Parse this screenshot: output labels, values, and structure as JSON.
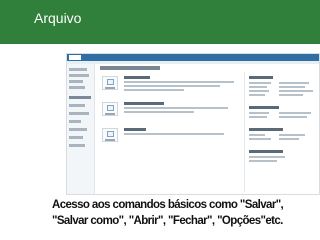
{
  "header": {
    "title": "Arquivo"
  },
  "caption": {
    "text": "Acesso aos comandos básicos como \"Salvar\", \"Salvar como\", \"Abrir\", \"Fechar\", \"Opções\"etc."
  },
  "colors": {
    "header_bg": "#307f3a",
    "header_text": "#ffffff",
    "ribbon": "#2f6fa3"
  }
}
